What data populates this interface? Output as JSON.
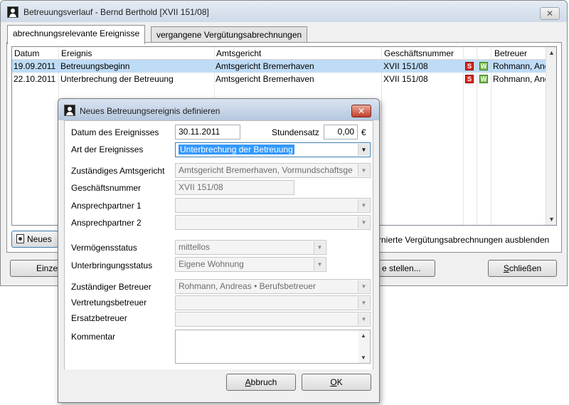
{
  "main_window": {
    "title": "Betreuungsverlauf - Bernd Berthold [XVII 151/08]",
    "tabs": [
      {
        "label": "abrechnungsrelevante Ereignisse",
        "active": true
      },
      {
        "label": "vergangene Vergütungsabrechnungen",
        "active": false
      }
    ],
    "table": {
      "columns": [
        "Datum",
        "Ereignis",
        "Amtsgericht",
        "Geschäftsnummer",
        "Betreuer"
      ],
      "rows": [
        {
          "datum": "19.09.2011",
          "ereignis": "Betreuungsbeginn",
          "amtsgericht": "Amtsgericht Bremerhaven",
          "geschaeftsnummer": "XVII 151/08",
          "badge_s": "S",
          "badge_w": "W",
          "betreuer": "Rohmann, Andr",
          "selected": true
        },
        {
          "datum": "22.10.2011",
          "ereignis": "Unterbrechung der Betreuung",
          "amtsgericht": "Amtsgericht Bremerhaven",
          "geschaeftsnummer": "XVII 151/08",
          "badge_s": "S",
          "badge_w": "W",
          "betreuer": "Rohmann, Andr",
          "selected": false
        }
      ]
    },
    "new_button_label": "Neues",
    "hide_label": "rnierte Vergütungsabrechnungen ausblenden",
    "left_button_label": "Einze",
    "mid_button_label": "e stellen...",
    "close_button_label": "Schließen",
    "close_button_mnemonic": "S",
    "close_button_rest": "chließen"
  },
  "dialog": {
    "title": "Neues Betreuungsereignis definieren",
    "labels": {
      "datum": "Datum des Ereignisses",
      "stundensatz": "Stundensatz",
      "art": "Art der Ereignisses",
      "amtsgericht": "Zuständiges Amtsgericht",
      "geschaeftsnummer": "Geschäftsnummer",
      "ansprech1": "Ansprechpartner 1",
      "ansprech2": "Ansprechpartner 2",
      "vermoegen": "Vermögensstatus",
      "unterbringung": "Unterbringungsstatus",
      "betreuer": "Zuständiger Betreuer",
      "vertretung": "Vertretungsbetreuer",
      "ersatz": "Ersatzbetreuer",
      "kommentar": "Kommentar"
    },
    "values": {
      "datum": "30.11.2011",
      "stundensatz": "0,00",
      "currency": "€",
      "art": "Unterbrechung der Betreuung",
      "amtsgericht": "Amtsgericht Bremerhaven, Vormundschaftsge",
      "geschaeftsnummer": "XVII 151/08",
      "ansprech1": "",
      "ansprech2": "",
      "vermoegen": "mittellos",
      "unterbringung": "Eigene Wohnung",
      "betreuer": "Rohmann, Andreas • Berufsbetreuer",
      "vertretung": "",
      "ersatz": "",
      "kommentar": ""
    },
    "buttons": {
      "cancel_mnemonic": "A",
      "cancel_rest": "bbruch",
      "ok_mnemonic": "O",
      "ok_rest": "K"
    }
  },
  "colors": {
    "selected_row": "#bfdcf6",
    "selection_highlight": "#3399ff",
    "close_button_red": "#c2402c",
    "badge_s": "#d8281e",
    "badge_w": "#7cbd55"
  },
  "icons": [
    "user-icon",
    "close-icon",
    "scroll-up-icon",
    "scroll-down-icon",
    "combo-arrow-icon",
    "new-document-icon"
  ]
}
